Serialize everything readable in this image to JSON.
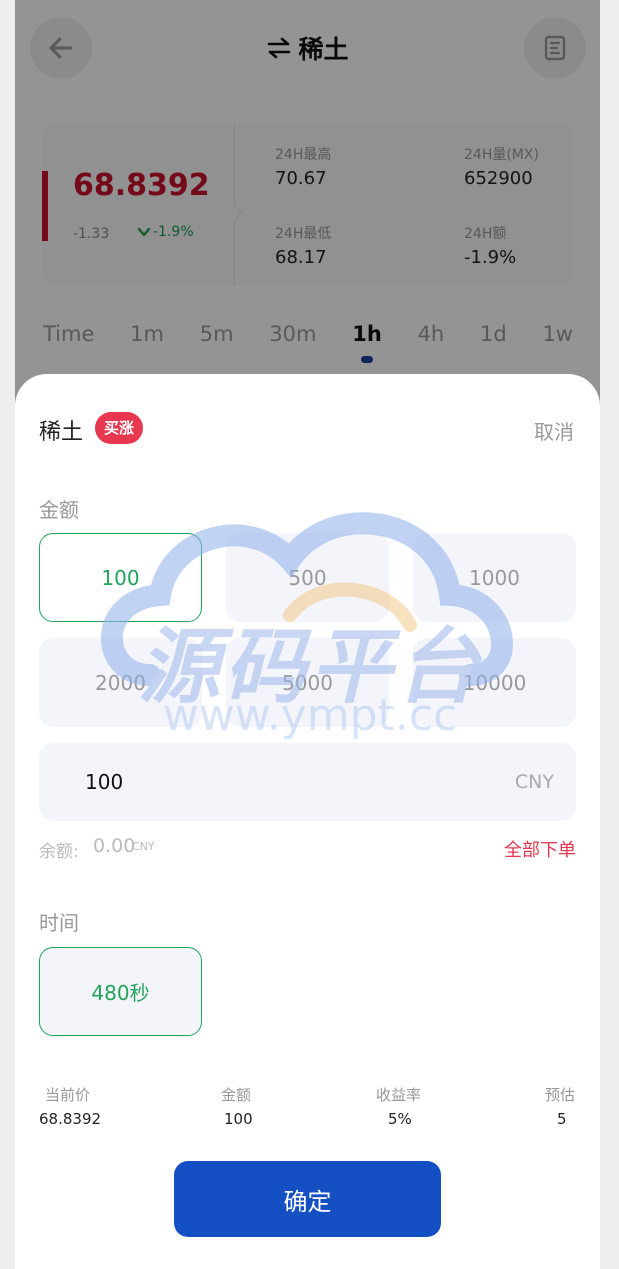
{
  "header": {
    "title": "稀土",
    "swap_icon": "swap-arrows-icon",
    "back_icon": "arrow-left-icon",
    "doc_icon": "document-icon"
  },
  "stats": {
    "price": "68.8392",
    "change": "-1.33",
    "change_pct": "-1.9%",
    "high_label": "24H最高",
    "high_value": "70.67",
    "volume_label": "24H量(MX)",
    "volume_value": "652900",
    "low_label": "24H最低",
    "low_value": "68.17",
    "amount_label": "24H额",
    "amount_value": "-1.9%"
  },
  "timeframes": {
    "items": [
      "Time",
      "1m",
      "5m",
      "30m",
      "1h",
      "4h",
      "1d",
      "1w"
    ],
    "active": "1h"
  },
  "sheet": {
    "title": "稀土",
    "badge": "买涨",
    "cancel": "取消",
    "amount_label": "金额",
    "amount_options": [
      "100",
      "500",
      "1000",
      "2000",
      "5000",
      "10000"
    ],
    "selected_amount": "100",
    "input_value": "100",
    "input_unit": "CNY",
    "balance_label": "余额:",
    "balance_value": "0.00",
    "balance_unit": "CNY",
    "all_order": "全部下单",
    "time_label": "时间",
    "time_option": "480秒",
    "summary": {
      "labels": [
        "当前价",
        "金额",
        "收益率",
        "预估"
      ],
      "values": [
        "68.8392",
        "100",
        "5%",
        "5"
      ]
    },
    "confirm": "确定"
  },
  "watermark": {
    "text": "源码平台",
    "url": "www.ympt.cc"
  },
  "colors": {
    "up_red": "#c8102e",
    "down_green": "#1f9d55",
    "select_green": "#22a35a",
    "badge_red": "#e8384f",
    "primary_blue": "#1450c4",
    "watermark_blue": "#9db8ec"
  }
}
